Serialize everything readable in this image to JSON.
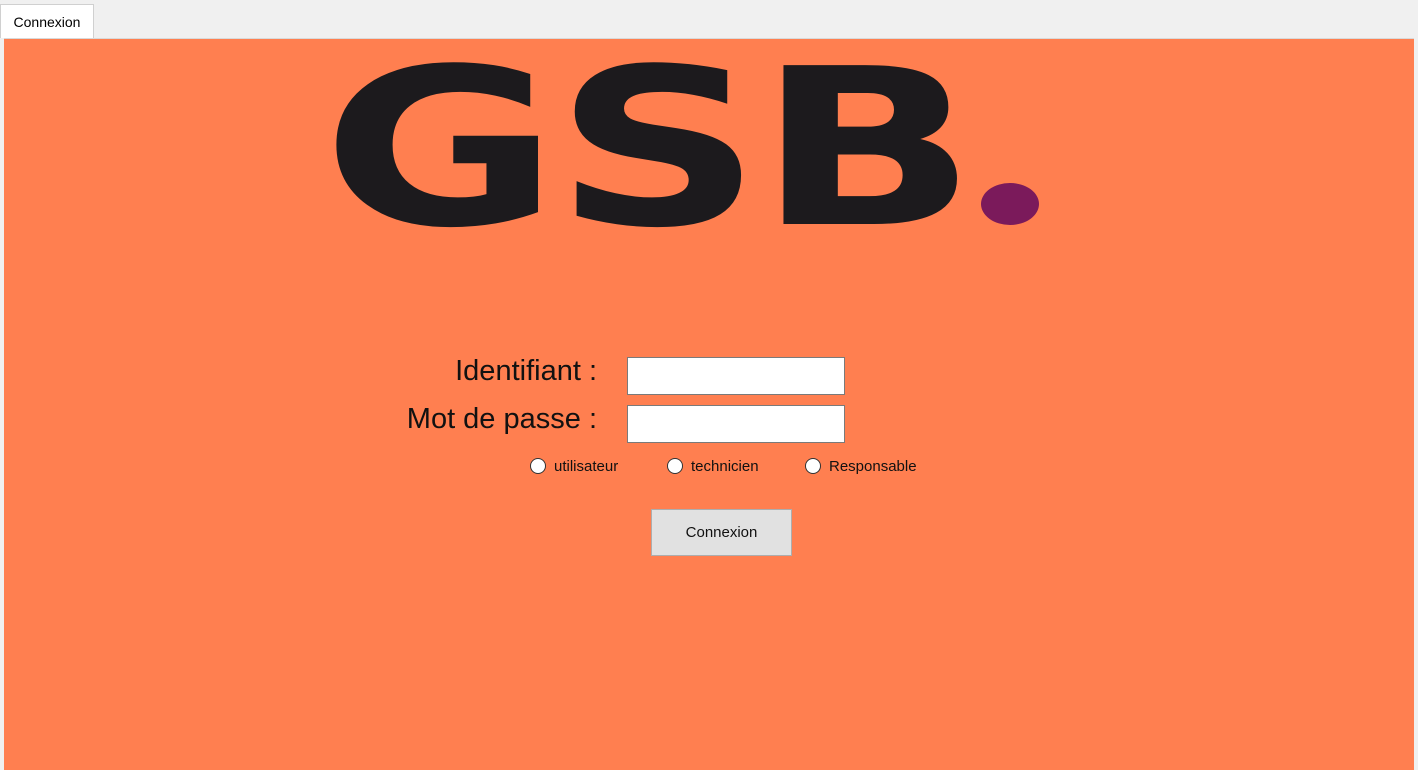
{
  "window": {
    "tab_label": "Connexion"
  },
  "logo": {
    "text": "GSB",
    "dot_color": "#7b1a5b",
    "letter_color": "#1c1a1d"
  },
  "form": {
    "username_label": "Identifiant :",
    "password_label": "Mot de passe :",
    "username_value": "",
    "password_value": "",
    "roles": [
      {
        "label": "utilisateur",
        "selected": false
      },
      {
        "label": "technicien",
        "selected": false
      },
      {
        "label": "Responsable",
        "selected": false
      }
    ],
    "submit_label": "Connexion"
  },
  "colors": {
    "panel_background": "#ff7f50"
  }
}
